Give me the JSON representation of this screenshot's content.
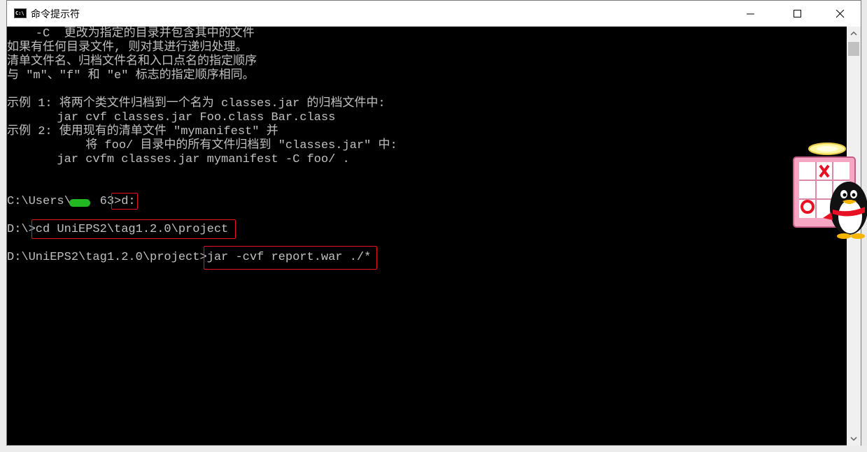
{
  "window": {
    "title": "命令提示符"
  },
  "console": {
    "lines": [
      "    -C  更改为指定的目录并包含其中的文件",
      "如果有任何目录文件, 则对其进行递归处理。",
      "清单文件名、归档文件名和入口点名的指定顺序",
      "与 \"m\"、\"f\" 和 \"e\" 标志的指定顺序相同。",
      "",
      "示例 1: 将两个类文件归档到一个名为 classes.jar 的归档文件中:",
      "       jar cvf classes.jar Foo.class Bar.class",
      "示例 2: 使用现有的清单文件 \"mymanifest\" 并",
      "           将 foo/ 目录中的所有文件归档到 \"classes.jar\" 中:",
      "       jar cvfm classes.jar mymanifest -C foo/ .",
      "",
      "",
      "C:\\Users\\    63>d:",
      "",
      "D:\\>cd UniEPS2\\tag1.2.0\\project",
      "",
      "D:\\UniEPS2\\tag1.2.0\\project>jar -cvf report.war ./*"
    ]
  },
  "annotations": {
    "color": "#e81123",
    "boxed_commands": [
      "d:",
      "cd UniEPS2\\tag1.2.0\\project",
      "jar -cvf report.war ./*"
    ]
  },
  "icons": {
    "app": "cmd-icon",
    "minimize": "minimize-icon",
    "maximize": "maximize-icon",
    "close": "close-icon",
    "mascot": "qq-penguin-mascot"
  }
}
